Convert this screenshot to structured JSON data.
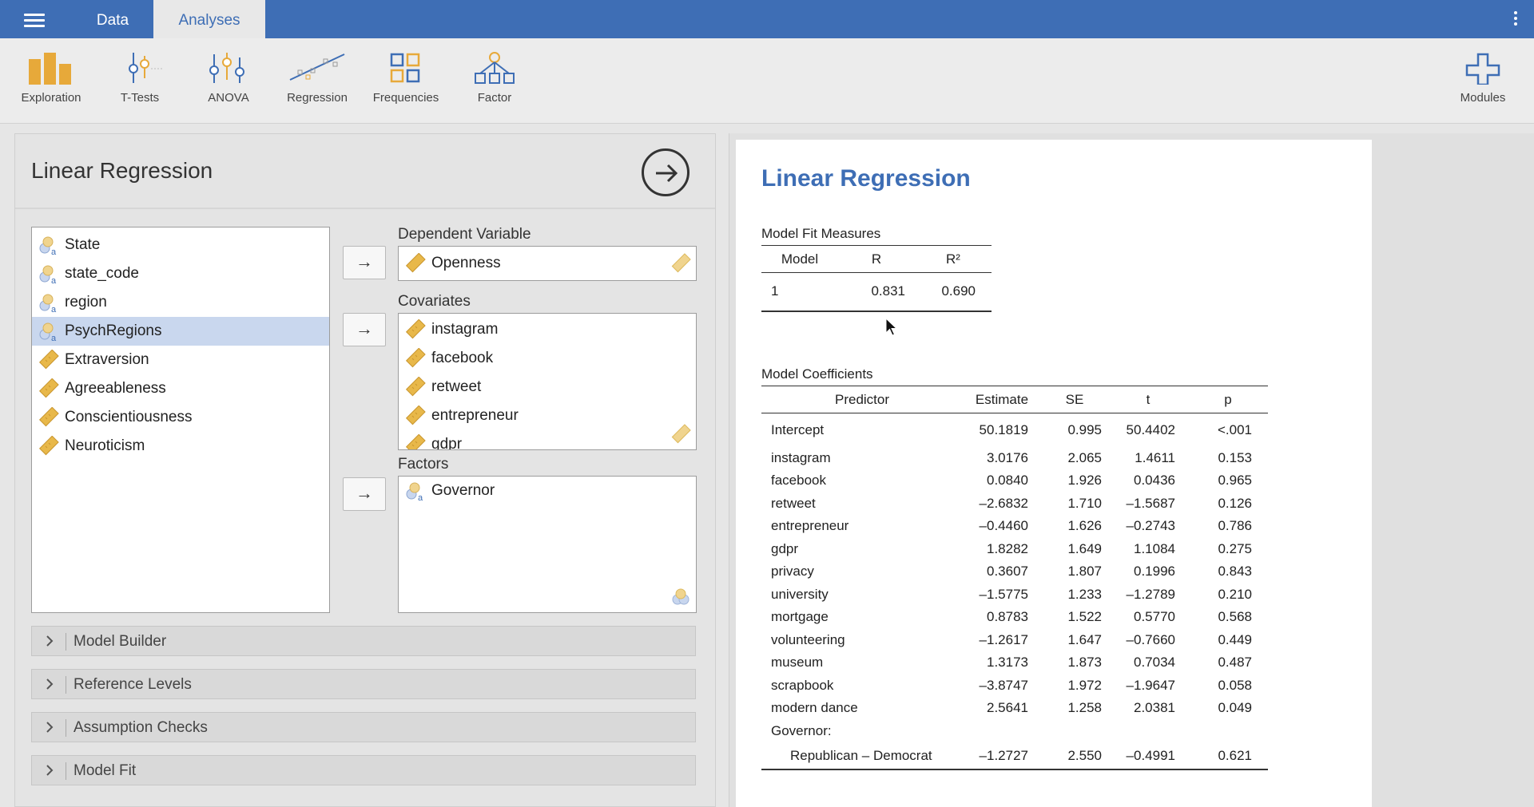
{
  "topbar": {
    "tabs": [
      {
        "label": "Data",
        "active": false
      },
      {
        "label": "Analyses",
        "active": true
      }
    ]
  },
  "ribbon": {
    "buttons": [
      {
        "label": "Exploration",
        "icon": "exploration-icon"
      },
      {
        "label": "T-Tests",
        "icon": "t-tests-icon"
      },
      {
        "label": "ANOVA",
        "icon": "anova-icon"
      },
      {
        "label": "Regression",
        "icon": "regression-icon"
      },
      {
        "label": "Frequencies",
        "icon": "frequencies-icon"
      },
      {
        "label": "Factor",
        "icon": "factor-icon"
      }
    ],
    "modules_label": "Modules"
  },
  "options": {
    "title": "Linear Regression",
    "variables": [
      {
        "name": "State",
        "type": "nominal-text"
      },
      {
        "name": "state_code",
        "type": "nominal-text"
      },
      {
        "name": "region",
        "type": "nominal-text"
      },
      {
        "name": "PsychRegions",
        "type": "nominal-text",
        "selected": true
      },
      {
        "name": "Extraversion",
        "type": "continuous"
      },
      {
        "name": "Agreeableness",
        "type": "continuous"
      },
      {
        "name": "Conscientiousness",
        "type": "continuous"
      },
      {
        "name": "Neuroticism",
        "type": "continuous"
      }
    ],
    "dependent_label": "Dependent Variable",
    "dependent": "Openness",
    "covariates_label": "Covariates",
    "covariates": [
      "instagram",
      "facebook",
      "retweet",
      "entrepreneur",
      "gdpr"
    ],
    "factors_label": "Factors",
    "factors": [
      "Governor"
    ],
    "arrow": "→",
    "sections": [
      "Model Builder",
      "Reference Levels",
      "Assumption Checks",
      "Model Fit"
    ]
  },
  "results": {
    "title": "Linear Regression",
    "fit": {
      "title": "Model Fit Measures",
      "headers": [
        "Model",
        "R",
        "R²"
      ],
      "rows": [
        [
          "1",
          "0.831",
          "0.690"
        ]
      ]
    },
    "coef": {
      "title": "Model Coefficients",
      "headers": [
        "Predictor",
        "Estimate",
        "SE",
        "t",
        "p"
      ],
      "rows": [
        [
          "Intercept",
          "50.1819",
          "0.995",
          "50.4402",
          "<.001"
        ],
        [
          "instagram",
          "3.0176",
          "2.065",
          "1.4611",
          "0.153"
        ],
        [
          "facebook",
          "0.0840",
          "1.926",
          "0.0436",
          "0.965"
        ],
        [
          "retweet",
          "–2.6832",
          "1.710",
          "–1.5687",
          "0.126"
        ],
        [
          "entrepreneur",
          "–0.4460",
          "1.626",
          "–0.2743",
          "0.786"
        ],
        [
          "gdpr",
          "1.8282",
          "1.649",
          "1.1084",
          "0.275"
        ],
        [
          "privacy",
          "0.3607",
          "1.807",
          "0.1996",
          "0.843"
        ],
        [
          "university",
          "–1.5775",
          "1.233",
          "–1.2789",
          "0.210"
        ],
        [
          "mortgage",
          "0.8783",
          "1.522",
          "0.5770",
          "0.568"
        ],
        [
          "volunteering",
          "–1.2617",
          "1.647",
          "–0.7660",
          "0.449"
        ],
        [
          "museum",
          "1.3173",
          "1.873",
          "0.7034",
          "0.487"
        ],
        [
          "scrapbook",
          "–3.8747",
          "1.972",
          "–1.9647",
          "0.058"
        ],
        [
          "modern dance",
          "2.5641",
          "1.258",
          "2.0381",
          "0.049"
        ]
      ],
      "group_label": "Governor:",
      "group_row": [
        "Republican – Democrat",
        "–1.2727",
        "2.550",
        "–0.4991",
        "0.621"
      ]
    }
  },
  "colors": {
    "brand": "#3e6eb5",
    "selected": "#c9d7ee",
    "ruler": "#e8b84a"
  }
}
